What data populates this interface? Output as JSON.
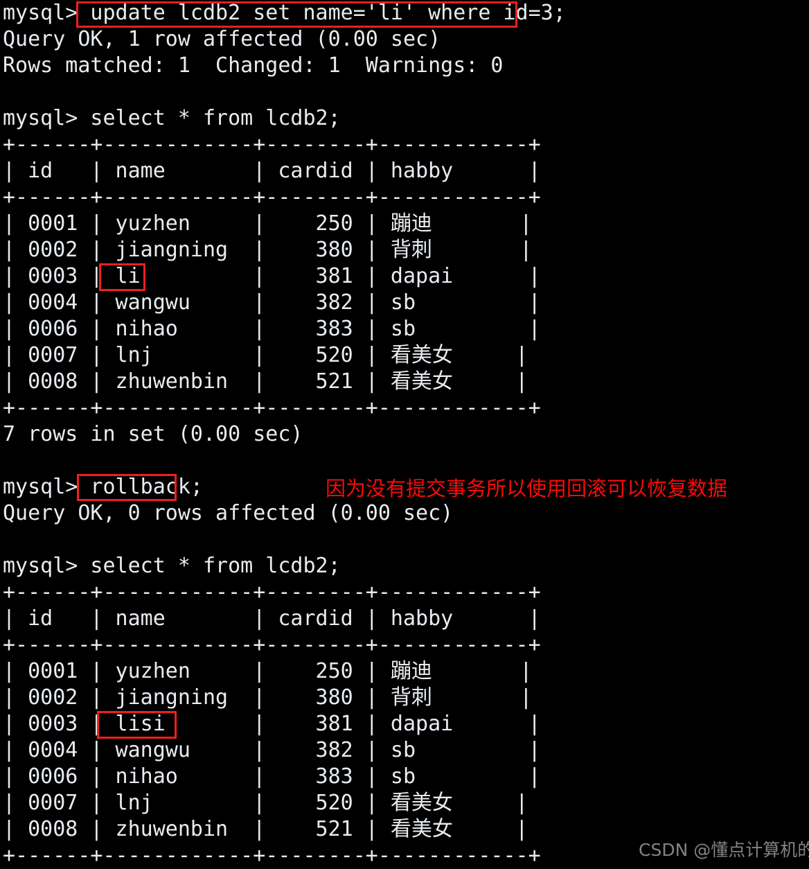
{
  "terminal": {
    "prompt": "mysql> ",
    "background_color": "#000000",
    "text_color": "#e8ecf0",
    "highlight_color": "#f41e1e",
    "annotation_color": "#fb0a0a",
    "lines": [
      {
        "text": "mysql> update lcdb2 set name='li' where id=3;",
        "name": "prompt-update-statement"
      },
      {
        "text": "Query OK, 1 row affected (0.00 sec)",
        "name": "result-query-ok-update"
      },
      {
        "text": "Rows matched: 1  Changed: 1  Warnings: 0",
        "name": "result-rows-matched"
      },
      {
        "text": "",
        "name": "blank-line"
      },
      {
        "text": "mysql> select * from lcdb2;",
        "name": "prompt-select-1"
      },
      {
        "text": "+------+------------+--------+------------+",
        "name": "table1-border-top"
      },
      {
        "text": "| id   | name       | cardid | habby      |",
        "name": "table1-header-row"
      },
      {
        "text": "+------+------------+--------+------------+",
        "name": "table1-border-header"
      },
      {
        "text": "| 0001 | yuzhen     |    250 | 蹦迪       |",
        "name": "table1-row-1"
      },
      {
        "text": "| 0002 | jiangning  |    380 | 背刺       |",
        "name": "table1-row-2"
      },
      {
        "text": "| 0003 | li         |    381 | dapai      |",
        "name": "table1-row-3"
      },
      {
        "text": "| 0004 | wangwu     |    382 | sb         |",
        "name": "table1-row-4"
      },
      {
        "text": "| 0006 | nihao      |    383 | sb         |",
        "name": "table1-row-5"
      },
      {
        "text": "| 0007 | lnj        |    520 | 看美女     |",
        "name": "table1-row-6"
      },
      {
        "text": "| 0008 | zhuwenbin  |    521 | 看美女     |",
        "name": "table1-row-7"
      },
      {
        "text": "+------+------------+--------+------------+",
        "name": "table1-border-bottom"
      },
      {
        "text": "7 rows in set (0.00 sec)",
        "name": "result-rowcount-1"
      },
      {
        "text": "",
        "name": "blank-line"
      },
      {
        "text": "mysql> rollback;",
        "name": "prompt-rollback-statement"
      },
      {
        "text": "Query OK, 0 rows affected (0.00 sec)",
        "name": "result-query-ok-rollback"
      },
      {
        "text": "",
        "name": "blank-line"
      },
      {
        "text": "mysql> select * from lcdb2;",
        "name": "prompt-select-2"
      },
      {
        "text": "+------+------------+--------+------------+",
        "name": "table2-border-top"
      },
      {
        "text": "| id   | name       | cardid | habby      |",
        "name": "table2-header-row"
      },
      {
        "text": "+------+------------+--------+------------+",
        "name": "table2-border-header"
      },
      {
        "text": "| 0001 | yuzhen     |    250 | 蹦迪       |",
        "name": "table2-row-1"
      },
      {
        "text": "| 0002 | jiangning  |    380 | 背刺       |",
        "name": "table2-row-2"
      },
      {
        "text": "| 0003 | lisi       |    381 | dapai      |",
        "name": "table2-row-3"
      },
      {
        "text": "| 0004 | wangwu     |    382 | sb         |",
        "name": "table2-row-4"
      },
      {
        "text": "| 0006 | nihao      |    383 | sb         |",
        "name": "table2-row-5"
      },
      {
        "text": "| 0007 | lnj        |    520 | 看美女     |",
        "name": "table2-row-6"
      },
      {
        "text": "| 0008 | zhuwenbin  |    521 | 看美女     |",
        "name": "table2-row-7"
      },
      {
        "text": "+------+------------+--------+------------+",
        "name": "table2-border-bottom"
      }
    ]
  },
  "statements": {
    "update": "update lcdb2 set name='li' where id=3;",
    "select": "select * from lcdb2;",
    "rollback": "rollback;"
  },
  "table_1": {
    "columns": [
      "id",
      "name",
      "cardid",
      "habby"
    ],
    "rows": [
      [
        "0001",
        "yuzhen",
        "250",
        "蹦迪"
      ],
      [
        "0002",
        "jiangning",
        "380",
        "背刺"
      ],
      [
        "0003",
        "li",
        "381",
        "dapai"
      ],
      [
        "0004",
        "wangwu",
        "382",
        "sb"
      ],
      [
        "0006",
        "nihao",
        "383",
        "sb"
      ],
      [
        "0007",
        "lnj",
        "520",
        "看美女"
      ],
      [
        "0008",
        "zhuwenbin",
        "521",
        "看美女"
      ]
    ],
    "footer": "7 rows in set (0.00 sec)"
  },
  "table_2": {
    "columns": [
      "id",
      "name",
      "cardid",
      "habby"
    ],
    "rows": [
      [
        "0001",
        "yuzhen",
        "250",
        "蹦迪"
      ],
      [
        "0002",
        "jiangning",
        "380",
        "背刺"
      ],
      [
        "0003",
        "lisi",
        "381",
        "dapai"
      ],
      [
        "0004",
        "wangwu",
        "382",
        "sb"
      ],
      [
        "0006",
        "nihao",
        "383",
        "sb"
      ],
      [
        "0007",
        "lnj",
        "520",
        "看美女"
      ],
      [
        "0008",
        "zhuwenbin",
        "521",
        "看美女"
      ]
    ]
  },
  "annotations": {
    "note_rollback": "因为没有提交事务所以使用回滚可以恢复数据",
    "highlight_update": "update lcdb2 set name='li' where id=3;",
    "highlight_value_before": "li",
    "highlight_rollback": "rollback;",
    "highlight_value_after": "lisi"
  },
  "watermark": {
    "text": "CSDN @懂点计算机的小白"
  }
}
